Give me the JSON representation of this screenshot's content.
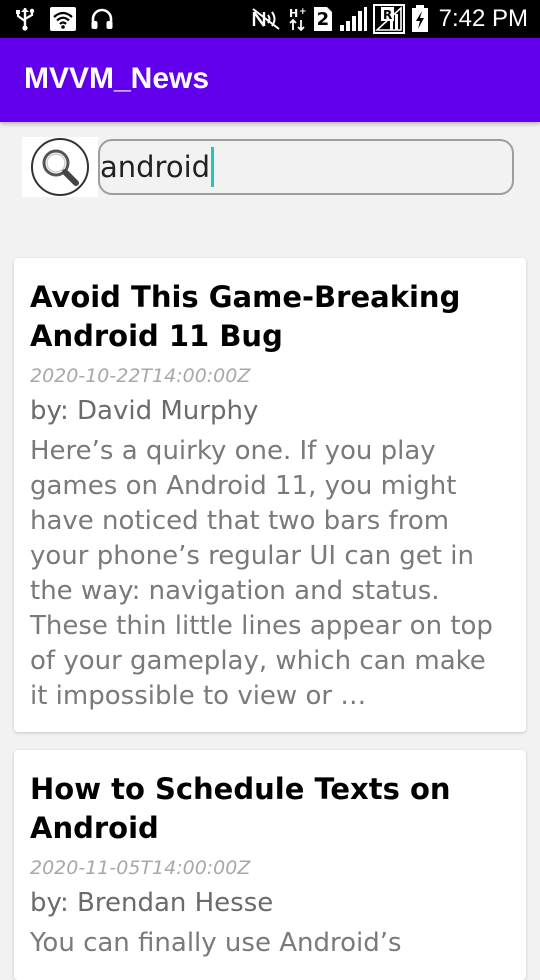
{
  "status_bar": {
    "time": "7:42 PM",
    "sim_label": "2",
    "icons": [
      "usb-icon",
      "wifi-icon",
      "headphones-icon",
      "nfc-icon",
      "data-arrows-icon",
      "sim-2-icon",
      "signal-icon",
      "roaming-signal-icon",
      "battery-charging-icon"
    ]
  },
  "app_bar": {
    "title": "MVVM_News",
    "color": "#6200ee"
  },
  "search": {
    "value": "android",
    "icon": "search-icon",
    "caret_color": "#1ec8b4"
  },
  "articles": [
    {
      "title": "Avoid This Game-Breaking Android 11 Bug",
      "published_at": "2020-10-22T14:00:00Z",
      "author": "by: David Murphy",
      "description": "Here’s a quirky one. If you play games on Android 11, you might have noticed that two bars from your phone’s regular UI can get in the way: navigation and status. These thin little lines appear on top of your gameplay, which can make it impossible to view or …"
    },
    {
      "title": "How to Schedule Texts on Android",
      "published_at": "2020-11-05T14:00:00Z",
      "author": "by: Brendan Hesse",
      "description": "You can finally use Android’s"
    }
  ]
}
